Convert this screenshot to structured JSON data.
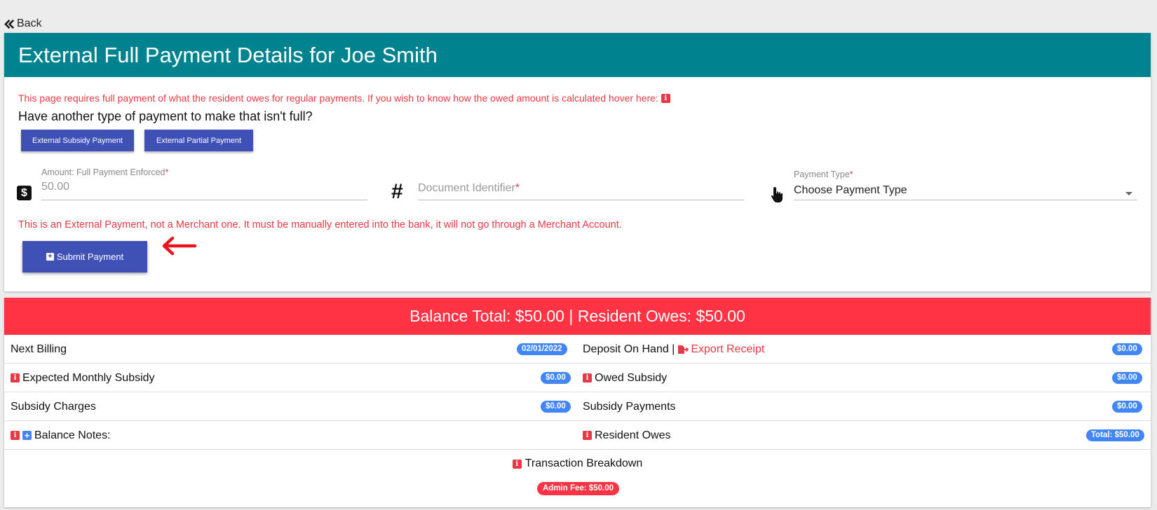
{
  "nav": {
    "back_label": "Back"
  },
  "payment_card": {
    "title": "External Full Payment Details for Joe Smith",
    "notice": "This page requires full payment of what the resident owes for regular payments. If you wish to know how the owed amount is calculated hover here:",
    "other_question": "Have another type of payment to make that isn't full?",
    "buttons": {
      "subsidy": "External Subsidy Payment",
      "partial": "External Partial Payment"
    },
    "amount": {
      "label": "Amount: Full Payment Enforced",
      "value": "50.00"
    },
    "document": {
      "label": "Document Identifier"
    },
    "payment_type": {
      "label": "Payment Type",
      "selected": "Choose Payment Type"
    },
    "required_mark": "*",
    "external_note": "This is an External Payment, not a Merchant one. It must be manually entered into the bank, it will not go through a Merchant Account.",
    "submit_label": "Submit Payment"
  },
  "balance_card": {
    "title": "Balance Total: $50.00 | Resident Owes: $50.00",
    "rows": [
      {
        "left_label": "Next Billing",
        "left_value": "02/01/2022",
        "right_label": "Deposit On Hand |",
        "right_link": "Export Receipt",
        "right_value": "$0.00"
      },
      {
        "left_label": "Expected Monthly Subsidy",
        "left_value": "$0.00",
        "right_label": "Owed Subsidy",
        "right_value": "$0.00"
      },
      {
        "left_label": "Subsidy Charges",
        "left_value": "$0.00",
        "right_label": "Subsidy Payments",
        "right_value": "$0.00"
      },
      {
        "left_label": "Balance Notes:",
        "right_label": "Resident Owes",
        "right_value": "Total: $50.00"
      }
    ],
    "breakdown_label": "Transaction Breakdown",
    "admin_fee": "Admin Fee: $50.00"
  },
  "colors": {
    "header_teal": "#00838f",
    "balance_red": "#ff3344",
    "button_indigo": "#3f51b5",
    "pill_blue": "#4285f4",
    "alert_red": "#e53945"
  },
  "icons": [
    "double-chevron-left-icon",
    "info-icon",
    "dollar-icon",
    "hash-icon",
    "hand-pointer-icon",
    "plus-square-icon",
    "red-arrow-icon",
    "file-export-icon"
  ]
}
